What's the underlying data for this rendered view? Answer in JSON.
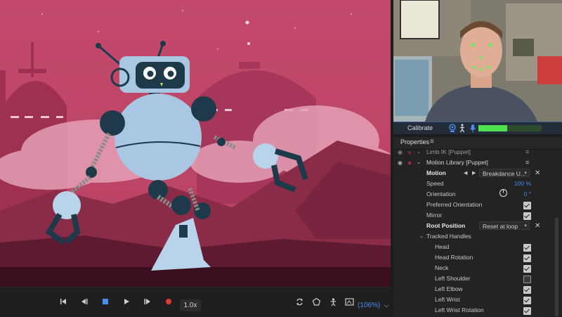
{
  "transport": {
    "buttons": [
      "go-to-start",
      "step-back",
      "stop",
      "play",
      "step-forward",
      "record"
    ],
    "speed": "1.0x",
    "zoom": "(106%)"
  },
  "camera": {
    "calibrate_label": "Calibrate",
    "mic_level": 0.45
  },
  "properties": {
    "title": "Properties",
    "rows": [
      {
        "type": "layer",
        "label": "Limb IK [Puppet]"
      },
      {
        "type": "layer",
        "label": "Motion Library [Puppet]"
      },
      {
        "type": "motion",
        "label": "Motion",
        "value": "Breakdance U..."
      },
      {
        "type": "value",
        "label": "Speed",
        "value": "100 %"
      },
      {
        "type": "value",
        "label": "Orientation",
        "value": "0 °"
      },
      {
        "type": "check",
        "label": "Preferred Orientation",
        "checked": true
      },
      {
        "type": "check",
        "label": "Mirror",
        "checked": true
      },
      {
        "type": "root",
        "label": "Root Position",
        "value": "Reset at loop"
      },
      {
        "type": "group",
        "label": "Tracked Handles"
      },
      {
        "type": "handle",
        "label": "Head",
        "checked": true
      },
      {
        "type": "handle",
        "label": "Head Rotation",
        "checked": true
      },
      {
        "type": "handle",
        "label": "Neck",
        "checked": true
      },
      {
        "type": "handle",
        "label": "Left Shoulder",
        "checked": false
      },
      {
        "type": "handle",
        "label": "Left Elbow",
        "checked": true
      },
      {
        "type": "handle",
        "label": "Left Wrist",
        "checked": true
      },
      {
        "type": "handle",
        "label": "Left Wrist Rotation",
        "checked": true
      }
    ]
  },
  "colors": {
    "accent_blue": "#4a8cf0",
    "meter_green": "#4ee04e",
    "scene_pink": "#c24a6c"
  }
}
